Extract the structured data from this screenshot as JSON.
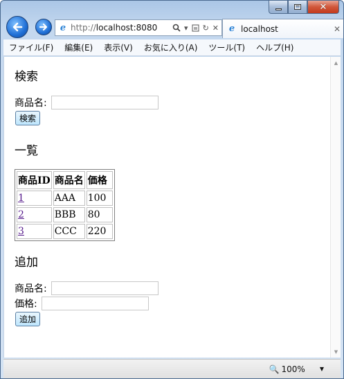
{
  "browser": {
    "address": {
      "scheme": "http://",
      "host": "localhost:8080"
    },
    "tab": {
      "label": "localhost"
    },
    "colors": {
      "accent": "#1f6fd6",
      "close": "#c33a1d"
    }
  },
  "menu": [
    "ファイル(F)",
    "編集(E)",
    "表示(V)",
    "お気に入り(A)",
    "ツール(T)",
    "ヘルプ(H)"
  ],
  "search": {
    "heading": "検索",
    "label": "商品名:",
    "value": "",
    "button": "検索"
  },
  "list": {
    "heading": "一覧",
    "columns": [
      "商品ID",
      "商品名",
      "価格"
    ],
    "rows": [
      {
        "id": "1",
        "name": "AAA",
        "price": "100"
      },
      {
        "id": "2",
        "name": "BBB",
        "price": "80"
      },
      {
        "id": "3",
        "name": "CCC",
        "price": "220"
      }
    ]
  },
  "add": {
    "heading": "追加",
    "name_label": "商品名:",
    "price_label": "価格:",
    "name_value": "",
    "price_value": "",
    "button": "追加"
  },
  "status": {
    "zoom": "100%"
  }
}
